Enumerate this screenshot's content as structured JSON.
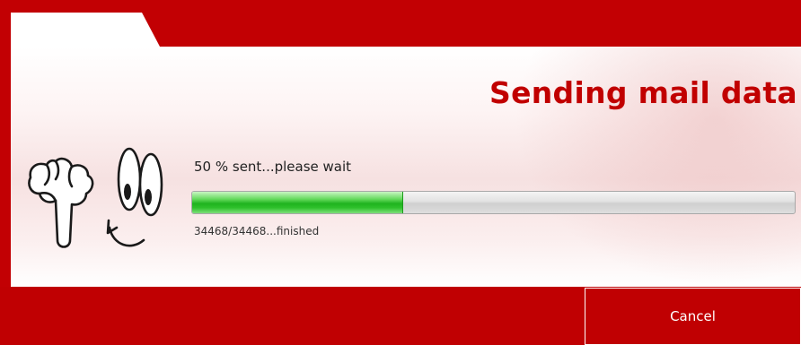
{
  "header": {
    "title": "Sending mail data"
  },
  "progress": {
    "status_text": "50 % sent...please wait",
    "fraction": 0.35,
    "count_text": "34468/34468...finished"
  },
  "footer": {
    "cancel_label": "Cancel"
  },
  "colors": {
    "brand_red": "#c00002",
    "title_red": "#c10000",
    "progress_green": "#1fb31f"
  },
  "icons": {
    "mascot": "pointing-hand-with-googly-eyes-icon"
  }
}
